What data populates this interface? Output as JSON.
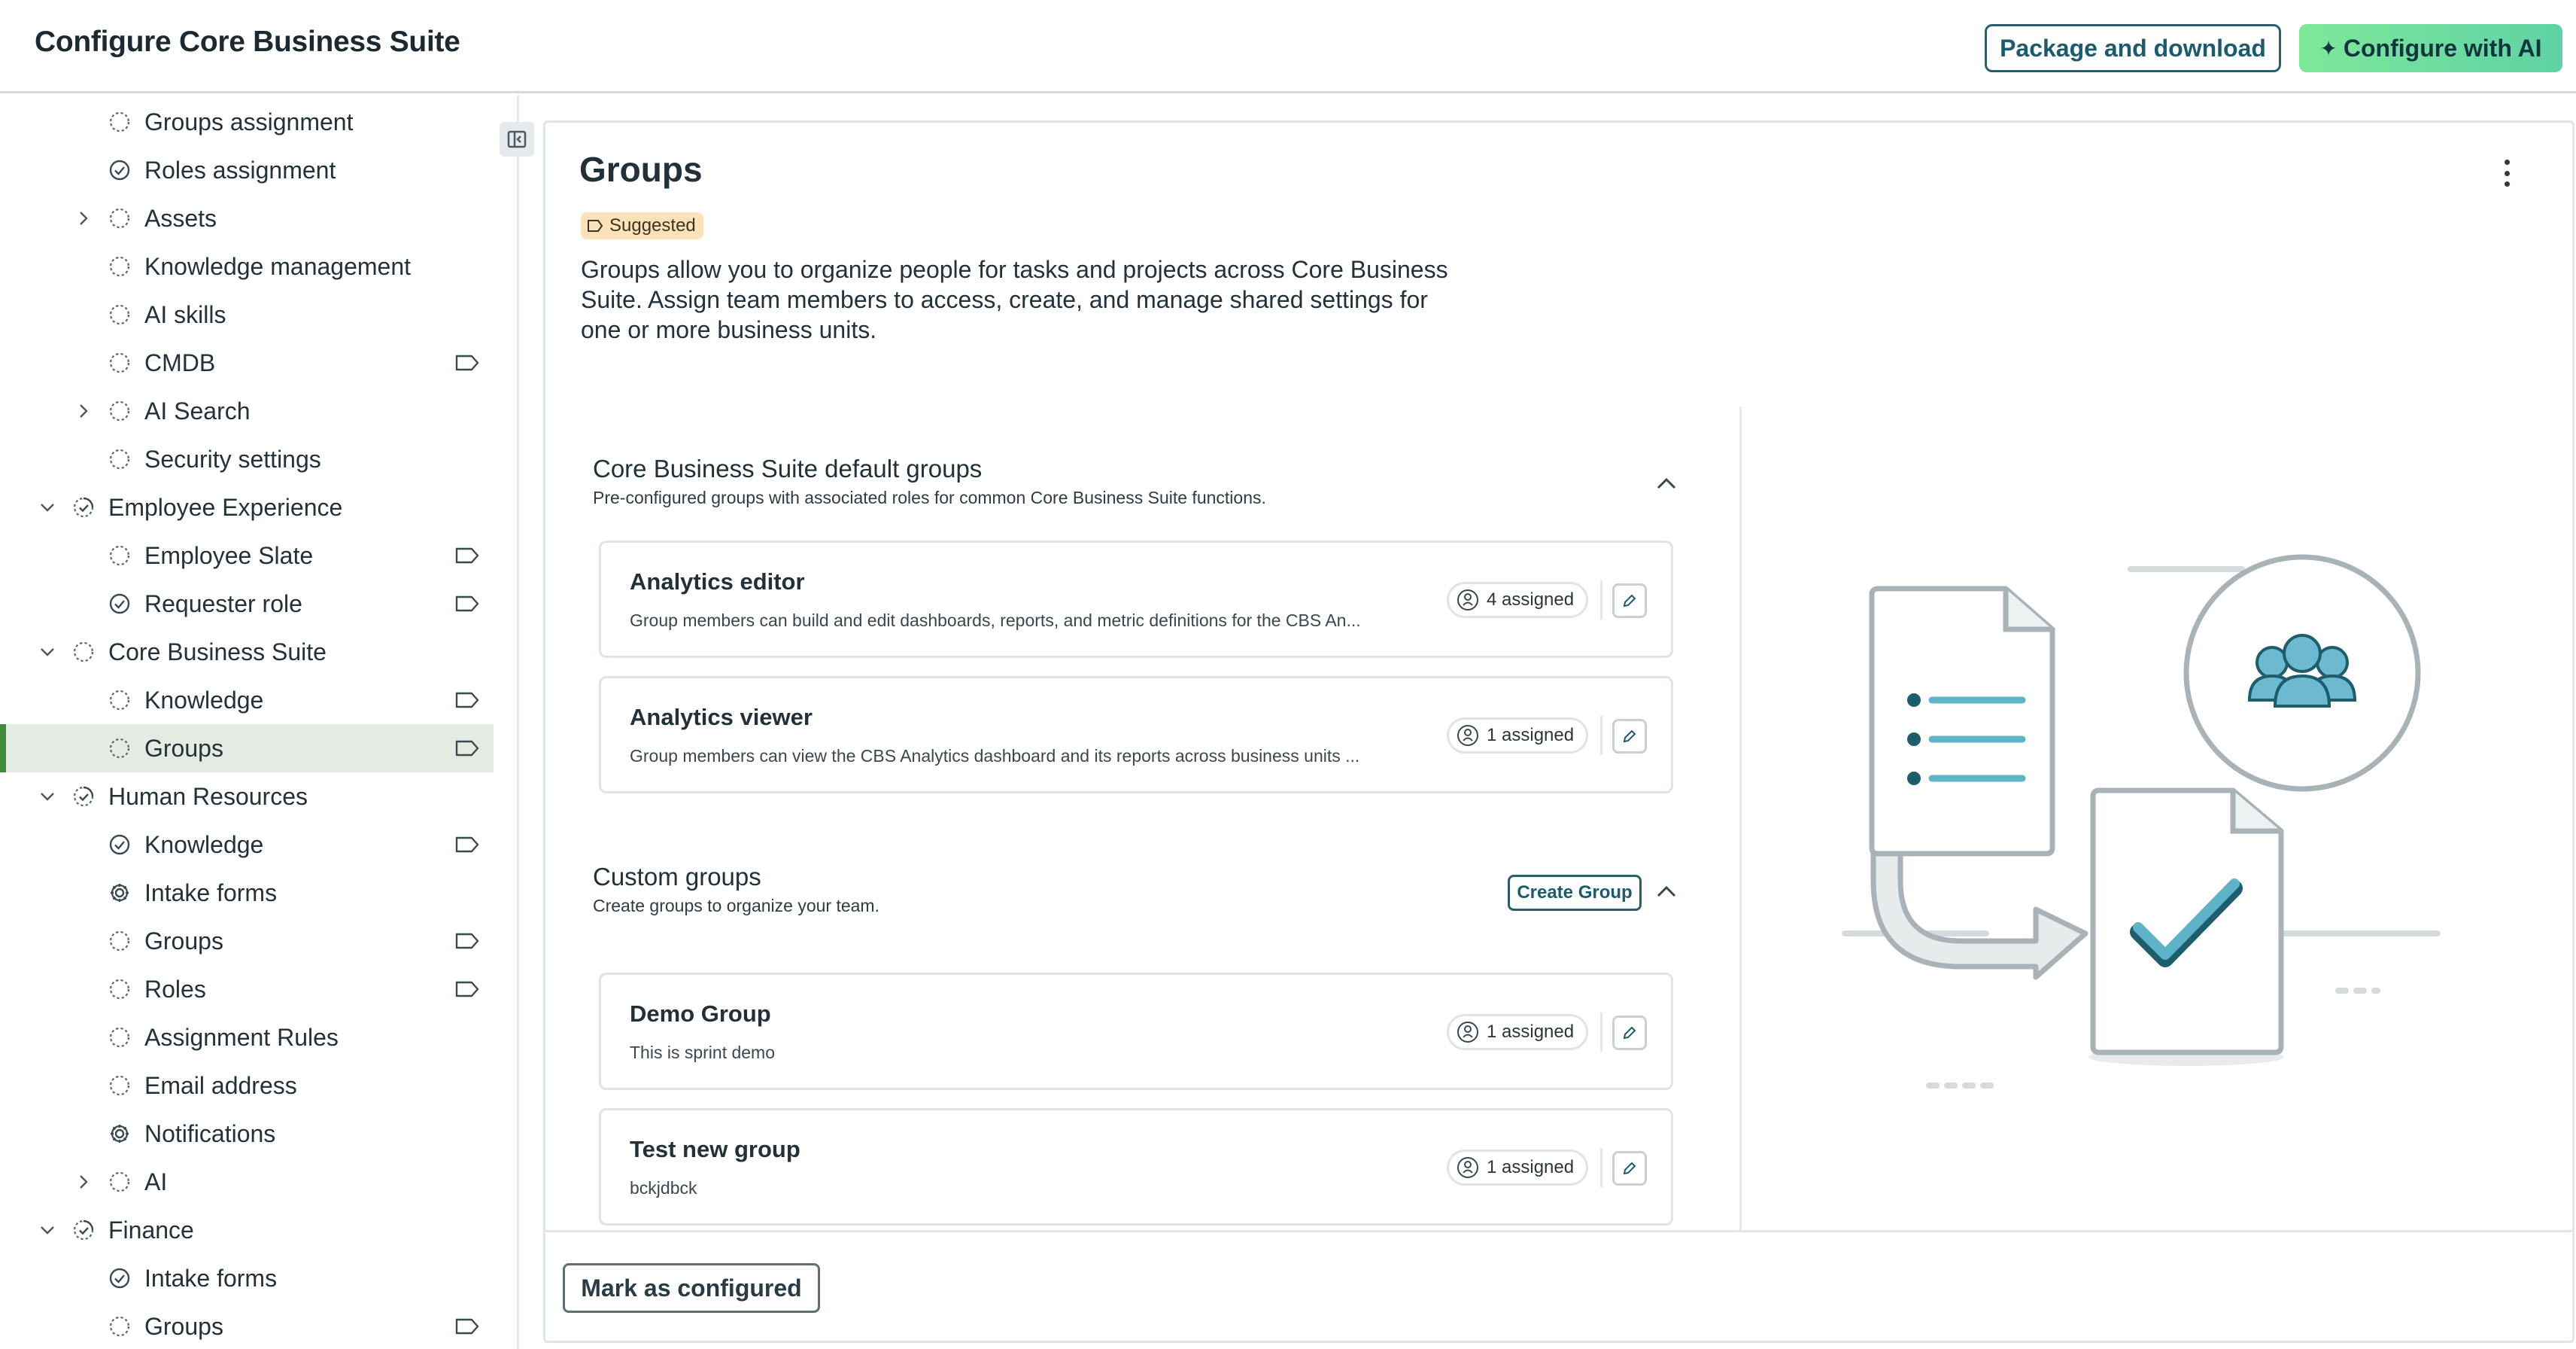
{
  "header": {
    "title": "Configure Core Business Suite",
    "package_label": "Package and download",
    "ai_label": "Configure with AI",
    "colors": {
      "accent": "#1c5a6e",
      "ai_gradient_start": "#7ee89a",
      "ai_gradient_end": "#5ed2a4"
    }
  },
  "sidebar": {
    "items": [
      {
        "label": "Groups assignment",
        "status": "pending-icon",
        "tag": false,
        "chevron": false,
        "indent": 2
      },
      {
        "label": "Roles assignment",
        "status": "completed-icon",
        "tag": false,
        "chevron": false,
        "indent": 2
      },
      {
        "label": "Assets",
        "status": "pending-icon",
        "tag": false,
        "chevron": "right",
        "indent": 2
      },
      {
        "label": "Knowledge management",
        "status": "pending-icon",
        "tag": false,
        "chevron": false,
        "indent": 2
      },
      {
        "label": "AI skills",
        "status": "pending-icon",
        "tag": false,
        "chevron": false,
        "indent": 2
      },
      {
        "label": "CMDB",
        "status": "pending-icon",
        "tag": true,
        "chevron": false,
        "indent": 2
      },
      {
        "label": "AI Search",
        "status": "pending-icon",
        "tag": false,
        "chevron": "right",
        "indent": 2
      },
      {
        "label": "Security settings",
        "status": "pending-icon",
        "tag": false,
        "chevron": false,
        "indent": 2
      },
      {
        "label": "Employee Experience",
        "status": "partial-icon",
        "tag": false,
        "chevron": "down",
        "indent": 1
      },
      {
        "label": "Employee Slate",
        "status": "pending-icon",
        "tag": true,
        "chevron": false,
        "indent": 2
      },
      {
        "label": "Requester role",
        "status": "completed-icon",
        "tag": true,
        "chevron": false,
        "indent": 2
      },
      {
        "label": "Core Business Suite",
        "status": "pending-icon",
        "tag": false,
        "chevron": "down",
        "indent": 1
      },
      {
        "label": "Knowledge",
        "status": "pending-icon",
        "tag": true,
        "chevron": false,
        "indent": 2
      },
      {
        "label": "Groups",
        "status": "pending-icon",
        "tag": true,
        "chevron": false,
        "indent": 2,
        "active": true
      },
      {
        "label": "Human Resources",
        "status": "partial-icon",
        "tag": false,
        "chevron": "down",
        "indent": 1
      },
      {
        "label": "Knowledge",
        "status": "completed-icon",
        "tag": true,
        "chevron": false,
        "indent": 2
      },
      {
        "label": "Intake forms",
        "status": "gear-icon",
        "tag": false,
        "chevron": false,
        "indent": 2
      },
      {
        "label": "Groups",
        "status": "pending-icon",
        "tag": true,
        "chevron": false,
        "indent": 2
      },
      {
        "label": "Roles",
        "status": "pending-icon",
        "tag": true,
        "chevron": false,
        "indent": 2
      },
      {
        "label": "Assignment Rules",
        "status": "pending-icon",
        "tag": false,
        "chevron": false,
        "indent": 2
      },
      {
        "label": "Email address",
        "status": "pending-icon",
        "tag": false,
        "chevron": false,
        "indent": 2
      },
      {
        "label": "Notifications",
        "status": "gear-icon",
        "tag": false,
        "chevron": false,
        "indent": 2
      },
      {
        "label": "AI",
        "status": "pending-icon",
        "tag": false,
        "chevron": "right",
        "indent": 2
      },
      {
        "label": "Finance",
        "status": "partial-icon",
        "tag": false,
        "chevron": "down",
        "indent": 1
      },
      {
        "label": "Intake forms",
        "status": "completed-icon",
        "tag": false,
        "chevron": false,
        "indent": 2
      },
      {
        "label": "Groups",
        "status": "pending-icon",
        "tag": true,
        "chevron": false,
        "indent": 2
      }
    ]
  },
  "main": {
    "title": "Groups",
    "badge": "Suggested",
    "description": "Groups allow you to organize people for tasks and projects across Core Business Suite. Assign team members to access, create, and manage shared settings for one or more business units.",
    "default_section": {
      "title": "Core Business Suite default groups",
      "subtitle": "Pre-configured groups with associated roles for common Core Business Suite functions.",
      "cards": [
        {
          "title": "Analytics editor",
          "description": "Group members can build and edit dashboards, reports, and metric definitions for the CBS An...",
          "assigned": "4 assigned"
        },
        {
          "title": "Analytics viewer",
          "description": "Group members can view the CBS Analytics dashboard and its reports across business units ...",
          "assigned": "1 assigned"
        }
      ]
    },
    "custom_section": {
      "title": "Custom groups",
      "subtitle": "Create groups to organize your team.",
      "create_label": "Create Group",
      "cards": [
        {
          "title": "Demo Group",
          "description": "This is sprint demo",
          "assigned": "1 assigned"
        },
        {
          "title": "Test new group",
          "description": "bckjdbck",
          "assigned": "1 assigned"
        }
      ]
    },
    "footer": {
      "mark_label": "Mark as configured"
    }
  }
}
